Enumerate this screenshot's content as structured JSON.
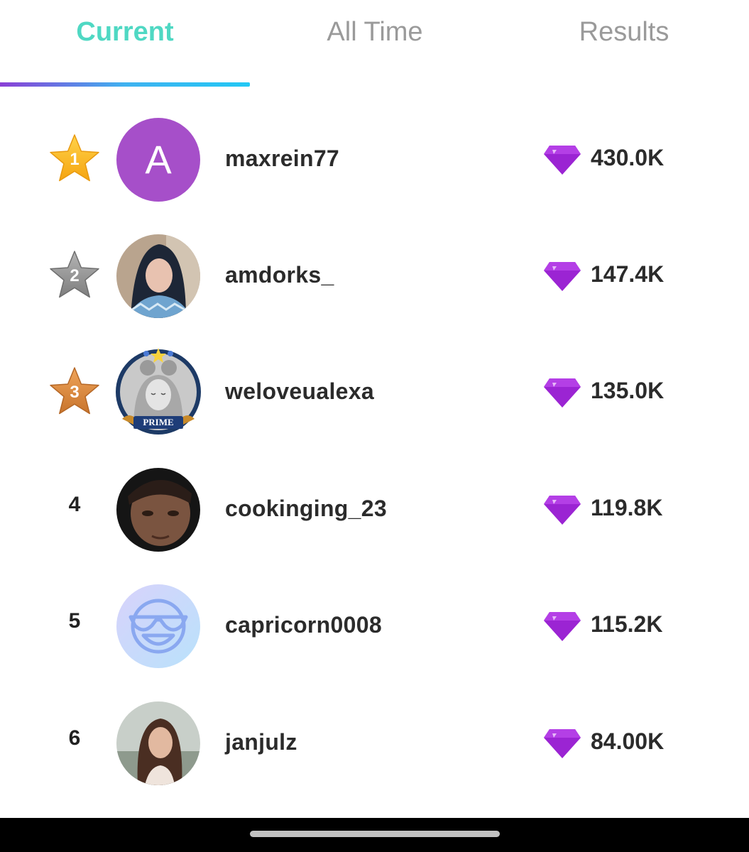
{
  "tabs": {
    "current": "Current",
    "all_time": "All Time",
    "results": "Results"
  },
  "rank_colors": {
    "gold": "#f7b21d",
    "silver": "#8e8e8e",
    "bronze": "#d88a3a"
  },
  "accent_color": "#4fd8c3",
  "gem_color": "#9b24d3",
  "rows": [
    {
      "rank": "1",
      "avatar_letter": "A",
      "username": "maxrein77",
      "score": "430.0K"
    },
    {
      "rank": "2",
      "username": "amdorks_",
      "score": "147.4K"
    },
    {
      "rank": "3",
      "username": "weloveualexa",
      "score": "135.0K",
      "badge": "PRIME"
    },
    {
      "rank": "4",
      "username": "cookinging_23",
      "score": "119.8K"
    },
    {
      "rank": "5",
      "username": "capricorn0008",
      "score": "115.2K"
    },
    {
      "rank": "6",
      "username": "janjulz",
      "score": "84.00K"
    }
  ]
}
